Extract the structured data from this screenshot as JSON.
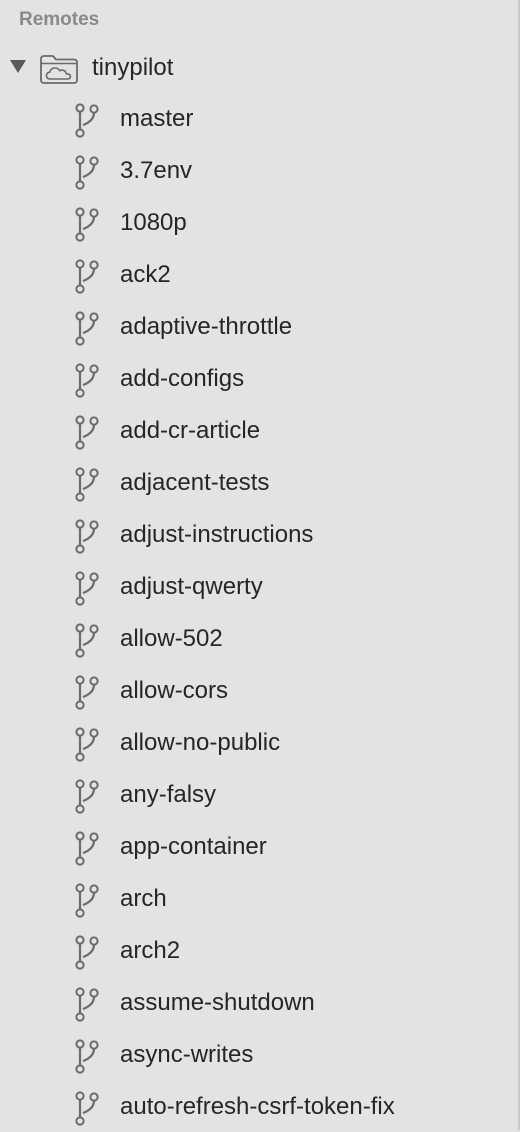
{
  "sidebar": {
    "section_title": "Remotes",
    "remote": {
      "name": "tinypilot",
      "expanded": true,
      "icon": "cloud-folder-icon"
    },
    "branch_icon": "git-branch-icon",
    "branches": [
      "master",
      "3.7env",
      "1080p",
      "ack2",
      "adaptive-throttle",
      "add-configs",
      "add-cr-article",
      "adjacent-tests",
      "adjust-instructions",
      "adjust-qwerty",
      "allow-502",
      "allow-cors",
      "allow-no-public",
      "any-falsy",
      "app-container",
      "arch",
      "arch2",
      "assume-shutdown",
      "async-writes",
      "auto-refresh-csrf-token-fix"
    ]
  },
  "colors": {
    "background": "#e3e3e3",
    "text": "#262626",
    "header_text": "#8a8a8a",
    "icon": "#6b6b6b"
  }
}
